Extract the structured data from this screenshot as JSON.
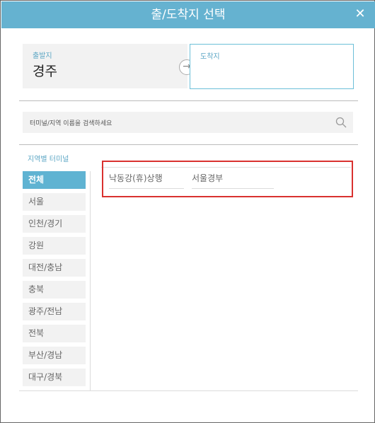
{
  "dialog": {
    "title": "출/도착지 선택",
    "close_icon": "close-icon"
  },
  "route": {
    "departure_label": "출발지",
    "departure_value": "경주",
    "swap_icon": "swap-arrow-icon",
    "arrival_label": "도착지",
    "arrival_value": ""
  },
  "search": {
    "placeholder": "터미널/지역 이름을 검색하세요",
    "icon": "search-icon"
  },
  "regions": {
    "label": "지역별 터미널",
    "items": [
      {
        "label": "전체",
        "active": true
      },
      {
        "label": "서울",
        "active": false
      },
      {
        "label": "인천/경기",
        "active": false
      },
      {
        "label": "강원",
        "active": false
      },
      {
        "label": "대전/충남",
        "active": false
      },
      {
        "label": "충북",
        "active": false
      },
      {
        "label": "광주/전남",
        "active": false
      },
      {
        "label": "전북",
        "active": false
      },
      {
        "label": "부산/경남",
        "active": false
      },
      {
        "label": "대구/경북",
        "active": false
      }
    ]
  },
  "terminals": {
    "items": [
      {
        "label": "낙동강(휴)상행"
      },
      {
        "label": "서울경부"
      }
    ]
  },
  "colors": {
    "header": "#65b2d0",
    "accent": "#5fb3d2",
    "highlight": "#d9312f"
  }
}
